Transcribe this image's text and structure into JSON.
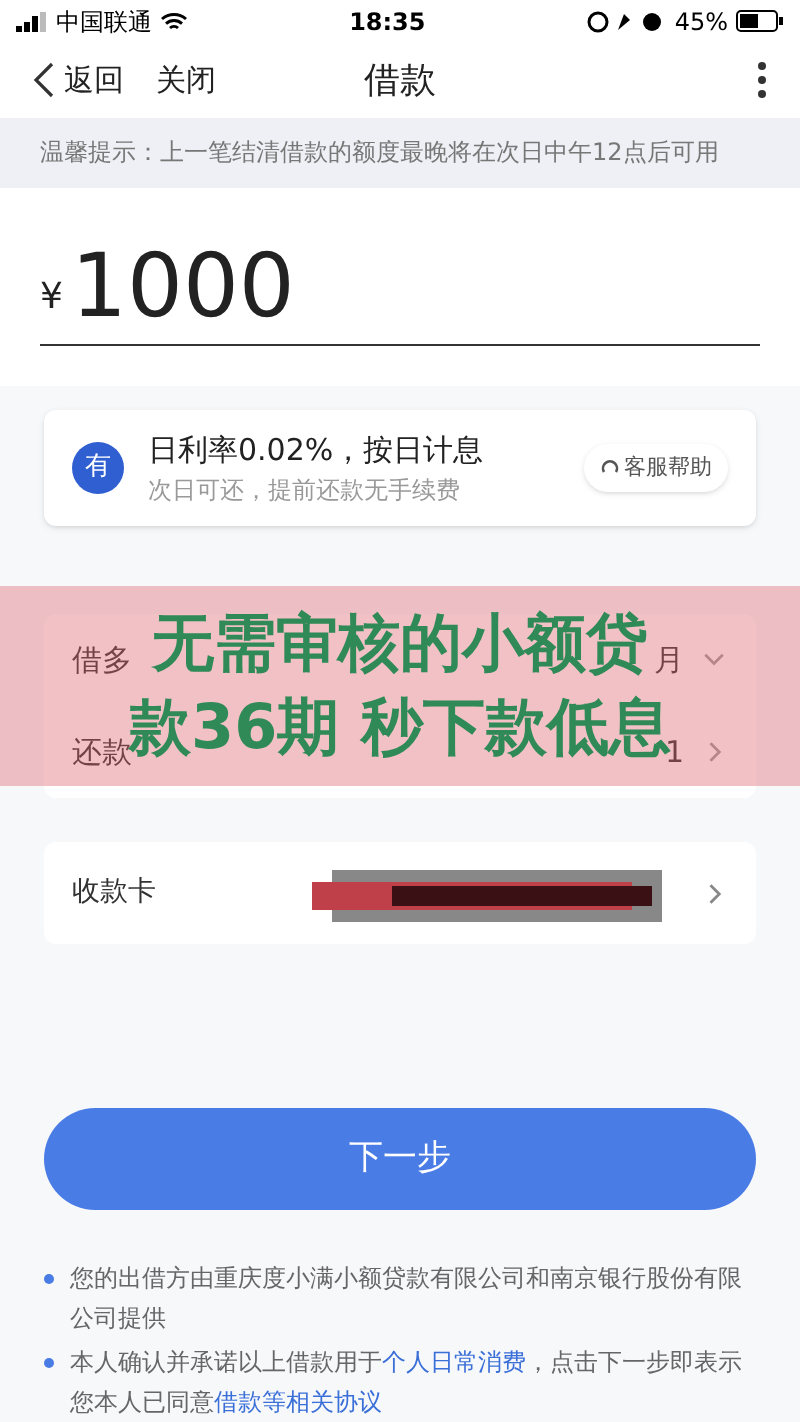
{
  "status_bar": {
    "carrier": "中国联通",
    "time": "18:35",
    "battery": "45%"
  },
  "nav": {
    "back": "返回",
    "close": "关闭",
    "title": "借款"
  },
  "notice": "温馨提示：上一笔结清借款的额度最晚将在次日中午12点后可用",
  "amount": {
    "currency": "¥",
    "value": "1000"
  },
  "rate_card": {
    "badge": "有",
    "title": "日利率0.02%，按日计息",
    "subtitle": "次日可还，提前还款无手续费",
    "help": "客服帮助"
  },
  "rows": [
    {
      "label": "借多",
      "value": "月",
      "kind": "dropdown"
    },
    {
      "label": "还款",
      "value": "1",
      "kind": "link"
    }
  ],
  "banner": [
    "无需审核的小额贷",
    "款36期 秒下款低息"
  ],
  "card_row": {
    "label": "收款卡"
  },
  "next_button": "下一步",
  "notes": [
    {
      "text": "您的出借方由重庆度小满小额贷款有限公司和南京银行股份有限公司提供"
    },
    {
      "text": "本人确认并承诺以上借款用于",
      "link": "个人日常消费",
      "text2": "，点击下一步即表示您本人已同意",
      "link2": "借款等相关协议"
    }
  ]
}
